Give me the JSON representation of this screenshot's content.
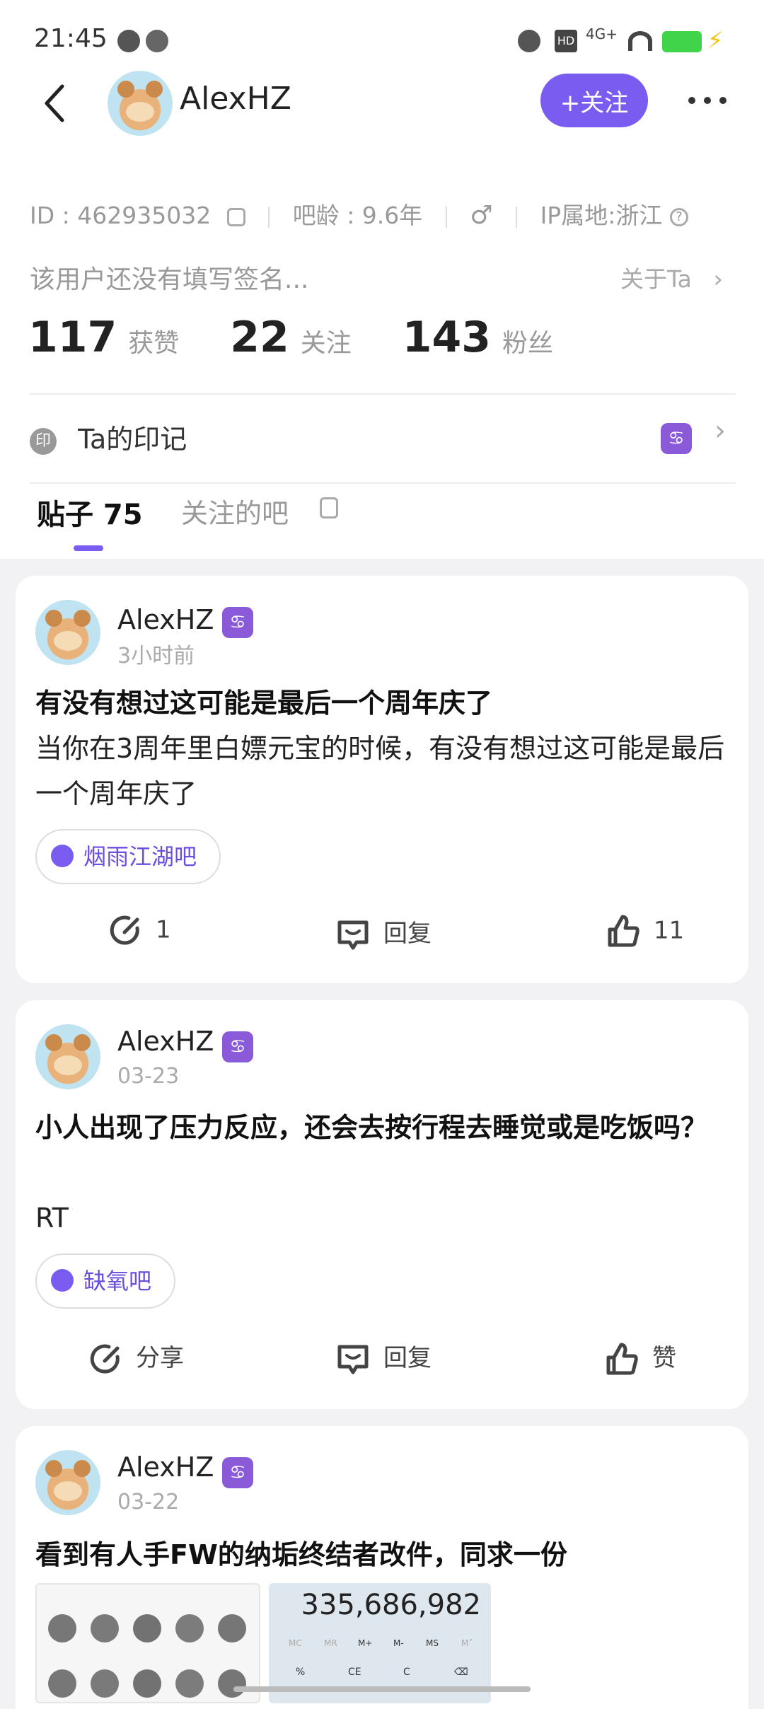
{
  "status_bar": {
    "time": "21:45",
    "network": "4G+",
    "hd": "HD"
  },
  "nav": {
    "back_icon": "chevron-left-icon",
    "username": "AlexHZ",
    "follow_label": "+关注",
    "more_icon": "more-dots-icon"
  },
  "profile": {
    "display_name": "AlexHZ",
    "id_text": "ID : 462935032",
    "bar_age": "吧龄 : 9.6年",
    "ip_location": "IP属地:浙江",
    "signature": "该用户还没有填写签名...",
    "about_label": "关于Ta",
    "stats": [
      {
        "value": "117",
        "label": "获赞"
      },
      {
        "value": "22",
        "label": "关注"
      },
      {
        "value": "143",
        "label": "粉丝"
      }
    ],
    "mark_badge": "印",
    "mark_label": "Ta的印记"
  },
  "tabs": [
    {
      "label": "贴子 75",
      "active": true
    },
    {
      "label": "关注的吧",
      "active": false
    }
  ],
  "posts": [
    {
      "author": "AlexHZ",
      "time": "3小时前",
      "title": "有没有想过这可能是最后一个周年庆了",
      "body": "当你在3周年里白嫖元宝的时候，有没有想过这可能是最后一个周年庆了",
      "forum": "烟雨江湖吧",
      "share": "1",
      "reply": "回复",
      "like": "11"
    },
    {
      "author": "AlexHZ",
      "time": "03-23",
      "title": "小人出现了压力反应，还会去按行程去睡觉或是吃饭吗？",
      "body": "RT",
      "forum": "缺氧吧",
      "share": "分享",
      "reply": "回复",
      "like": "赞"
    },
    {
      "author": "AlexHZ",
      "time": "03-22",
      "title": "看到有人手FW的纳垢终结者改件，同求一份",
      "calc_display": "335,686,982",
      "calc_keys": [
        "MC",
        "MR",
        "M+",
        "M-",
        "MS",
        "M˅",
        "%",
        "CE",
        "C",
        "⌫"
      ]
    }
  ],
  "zodiac_badge": "♋",
  "colors": {
    "accent": "#7b5cf0",
    "badge": "#8a5ad8",
    "muted": "#999999"
  }
}
